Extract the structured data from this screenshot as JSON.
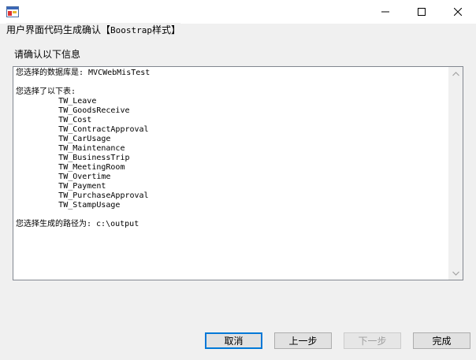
{
  "window": {
    "group_title_cn": "用户界面代码生成确认【",
    "group_title_code": "Boostrap",
    "group_title_end": "样式】"
  },
  "prompt": "请确认以下信息",
  "info_text": "您选择的数据库是: MVCWebMisTest\n\n您选择了以下表:\n         TW_Leave\n         TW_GoodsReceive\n         TW_Cost\n         TW_ContractApproval\n         TW_CarUsage\n         TW_Maintenance\n         TW_BusinessTrip\n         TW_MeetingRoom\n         TW_Overtime\n         TW_Payment\n         TW_PurchaseApproval\n         TW_StampUsage\n\n您选择生成的路径为: c:\\output",
  "buttons": {
    "cancel": "取消",
    "prev": "上一步",
    "next": "下一步",
    "finish": "完成"
  },
  "icons": {
    "app": "app-window-icon",
    "minimize": "minimize-icon",
    "maximize": "maximize-icon",
    "close": "close-icon",
    "scroll_up": "scroll-up-arrow-icon",
    "scroll_down": "scroll-down-arrow-icon"
  },
  "colors": {
    "focus_border": "#0078d7",
    "disabled_text": "#a0a0a0"
  }
}
